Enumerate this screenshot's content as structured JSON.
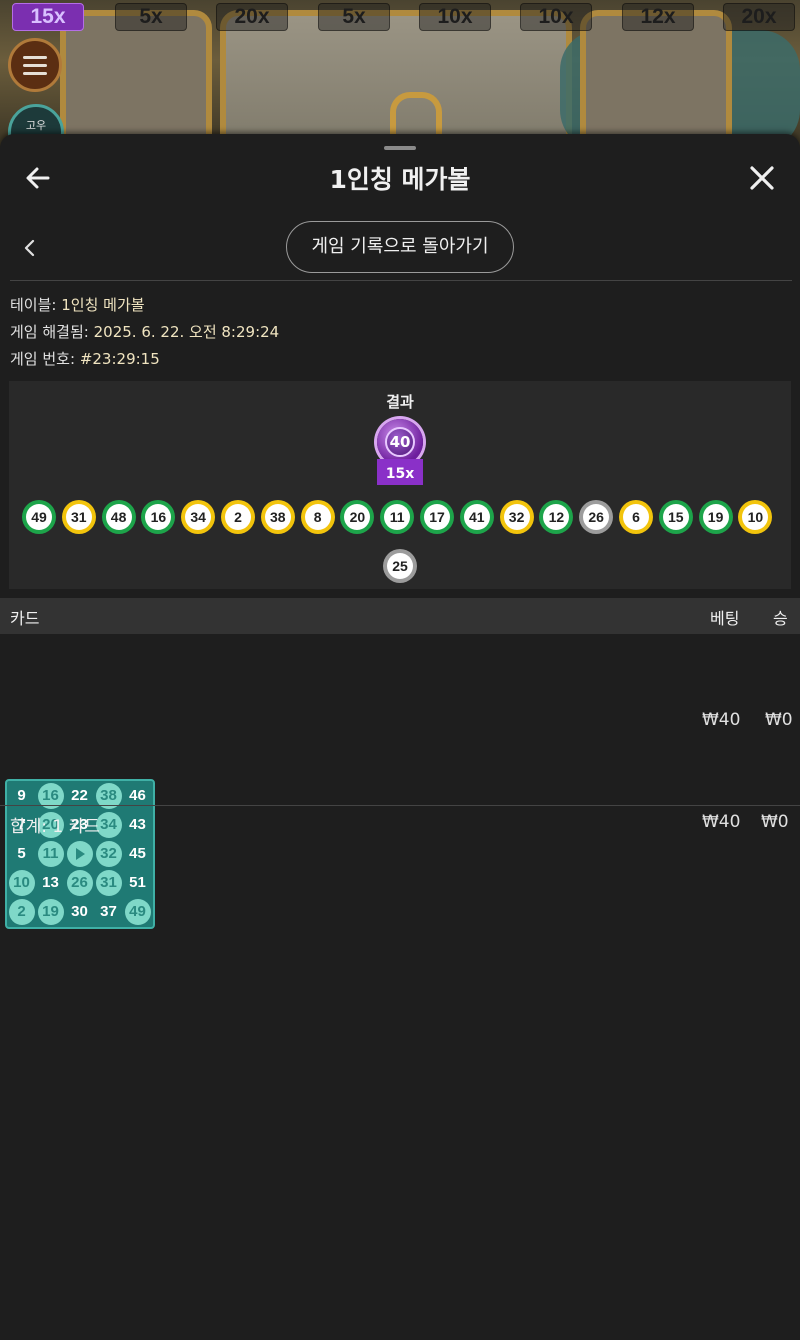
{
  "background": {
    "multipliers": [
      {
        "label": "15x",
        "active": true
      },
      {
        "label": "5x",
        "active": false
      },
      {
        "label": "20x",
        "active": false
      },
      {
        "label": "5x",
        "active": false
      },
      {
        "label": "10x",
        "active": false
      },
      {
        "label": "10x",
        "active": false
      },
      {
        "label": "12x",
        "active": false
      },
      {
        "label": "20x",
        "active": false
      }
    ],
    "menu_icon": "hamburger-icon",
    "chat_label": "고우"
  },
  "header": {
    "title": "1인칭 메가볼",
    "back_icon": "arrow-left-icon",
    "close_icon": "close-icon"
  },
  "nav": {
    "chevron_icon": "chevron-left-icon",
    "history_button": "게임 기록으로 돌아가기"
  },
  "info": {
    "table_label": "테이블:",
    "table_value": "1인칭 메가볼",
    "resolved_label": "게임 해결됨:",
    "resolved_value": "2025. 6. 22. 오전 8:29:24",
    "number_label": "게임 번호:",
    "number_value": "#23:29:15"
  },
  "result": {
    "title": "결과",
    "megaball": {
      "number": "40",
      "multiplier": "15x",
      "color": "#8a30c8"
    },
    "balls": [
      {
        "n": "49",
        "c": "green"
      },
      {
        "n": "31",
        "c": "yellow"
      },
      {
        "n": "48",
        "c": "green"
      },
      {
        "n": "16",
        "c": "green"
      },
      {
        "n": "34",
        "c": "yellow"
      },
      {
        "n": "2",
        "c": "yellow"
      },
      {
        "n": "38",
        "c": "yellow"
      },
      {
        "n": "8",
        "c": "yellow"
      },
      {
        "n": "20",
        "c": "green"
      },
      {
        "n": "11",
        "c": "green"
      },
      {
        "n": "17",
        "c": "green"
      },
      {
        "n": "41",
        "c": "green"
      },
      {
        "n": "32",
        "c": "yellow"
      },
      {
        "n": "12",
        "c": "green"
      },
      {
        "n": "26",
        "c": "white"
      },
      {
        "n": "6",
        "c": "yellow"
      },
      {
        "n": "15",
        "c": "green"
      },
      {
        "n": "19",
        "c": "green"
      },
      {
        "n": "10",
        "c": "yellow"
      },
      {
        "n": "25",
        "c": "white"
      }
    ]
  },
  "table": {
    "col_card": "카드",
    "col_bet": "베팅",
    "col_win": "승",
    "rows": [
      {
        "card": [
          [
            "9",
            "16",
            "22",
            "38",
            "46"
          ],
          [
            "7",
            "20",
            "23",
            "34",
            "43"
          ],
          [
            "5",
            "11",
            "",
            "32",
            "45"
          ],
          [
            "10",
            "13",
            "26",
            "31",
            "51"
          ],
          [
            "2",
            "19",
            "30",
            "37",
            "49"
          ]
        ],
        "hits": [
          [
            false,
            true,
            false,
            true,
            false
          ],
          [
            false,
            true,
            false,
            true,
            false
          ],
          [
            false,
            true,
            true,
            true,
            false
          ],
          [
            true,
            false,
            true,
            true,
            false
          ],
          [
            true,
            true,
            false,
            false,
            true
          ]
        ],
        "bet": "₩40",
        "win": "₩0"
      }
    ],
    "total_label": "합계: 1 카드",
    "total_bet": "₩40",
    "total_win": "₩0"
  }
}
